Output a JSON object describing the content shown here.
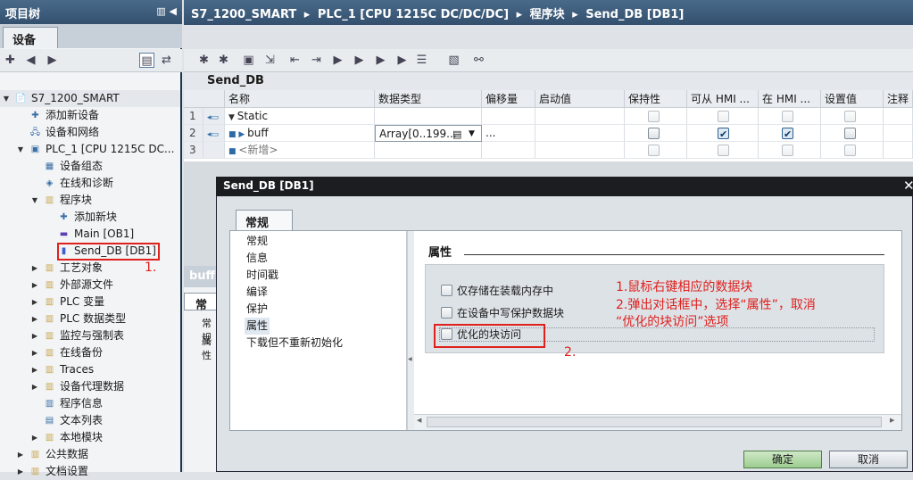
{
  "project_tree": {
    "title": "项目树",
    "header_buttons": "▥ ◀",
    "tab": "设备",
    "items": [
      {
        "label": "S7_1200_SMART",
        "level": 0,
        "expanded": true
      },
      {
        "label": "添加新设备",
        "level": 1
      },
      {
        "label": "设备和网络",
        "level": 1
      },
      {
        "label": "PLC_1 [CPU 1215C DC...",
        "level": 1,
        "expanded": true
      },
      {
        "label": "设备组态",
        "level": 2
      },
      {
        "label": "在线和诊断",
        "level": 2
      },
      {
        "label": "程序块",
        "level": 2,
        "expanded": true
      },
      {
        "label": "添加新块",
        "level": 3
      },
      {
        "label": "Main [OB1]",
        "level": 3
      },
      {
        "label": "Send_DB [DB1]",
        "level": 3,
        "selected": true
      },
      {
        "label": "工艺对象",
        "level": 2
      },
      {
        "label": "外部源文件",
        "level": 2
      },
      {
        "label": "PLC 变量",
        "level": 2
      },
      {
        "label": "PLC 数据类型",
        "level": 2
      },
      {
        "label": "监控与强制表",
        "level": 2
      },
      {
        "label": "在线备份",
        "level": 2
      },
      {
        "label": "Traces",
        "level": 2
      },
      {
        "label": "设备代理数据",
        "level": 2
      },
      {
        "label": "程序信息",
        "level": 2
      },
      {
        "label": "文本列表",
        "level": 2
      },
      {
        "label": "本地模块",
        "level": 2
      },
      {
        "label": "公共数据",
        "level": 1
      },
      {
        "label": "文档设置",
        "level": 1
      }
    ],
    "annotation_1": "1."
  },
  "breadcrumb": [
    "S7_1200_SMART",
    "PLC_1 [CPU 1215C DC/DC/DC]",
    "程序块",
    "Send_DB [DB1]"
  ],
  "breadcrumb_sep": "▸",
  "editor": {
    "block_title": "Send_DB",
    "columns": [
      "名称",
      "数据类型",
      "偏移量",
      "启动值",
      "保持性",
      "可从 HMI ...",
      "在 HMI ...",
      "设置值",
      "注释"
    ],
    "rows": [
      {
        "num": "1",
        "name": "Static",
        "type": "",
        "offset": "",
        "start": "",
        "retain": false,
        "hmi_access": false,
        "hmi_visible": false,
        "setpoint": false
      },
      {
        "num": "2",
        "name": "buff",
        "type": "Array[0..199...",
        "offset": "...",
        "start": "",
        "retain": false,
        "hmi_access": true,
        "hmi_visible": true,
        "setpoint": false
      },
      {
        "num": "3",
        "name": "<新增>",
        "type": "",
        "offset": "",
        "start": "",
        "retain": false,
        "hmi_access": false,
        "hmi_visible": false,
        "setpoint": false
      }
    ],
    "lower_tab": "buff",
    "lower_tab2": "常",
    "lower_labels": [
      "常规",
      "属性"
    ]
  },
  "dialog": {
    "title": "Send_DB [DB1]",
    "tab": "常规",
    "nav": [
      "常规",
      "信息",
      "时间戳",
      "编译",
      "保护",
      "属性",
      "下载但不重新初始化"
    ],
    "active_nav": "属性",
    "section_title": "属性",
    "options": [
      {
        "label": "仅存储在装载内存中",
        "checked": false
      },
      {
        "label": "在设备中写保护数据块",
        "checked": false
      },
      {
        "label": "优化的块访问",
        "checked": false
      }
    ],
    "annotation_text_1": "1.鼠标右键相应的数据块",
    "annotation_text_2": "2.弹出对话框中，选择“属性”，取消",
    "annotation_text_3": "“优化的块访问”选项",
    "annotation_2": "2.",
    "ok_button": "确定",
    "cancel_button": "取消"
  },
  "colors": {
    "accent_red": "#e0201c",
    "header_blue": "#33506e",
    "ok_green": "#9ccd8f"
  }
}
